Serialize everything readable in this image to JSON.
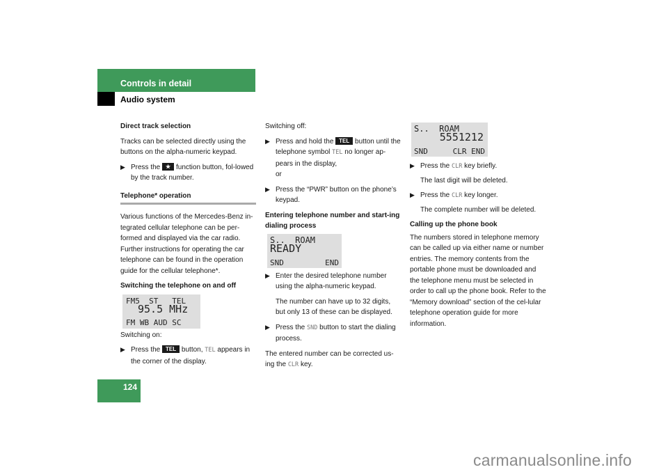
{
  "header": {
    "section_title": "Controls in detail",
    "subsection_title": "Audio system",
    "accent_color": "#3f9a5a"
  },
  "page_number": "124",
  "watermark": "carmanualsonline.info",
  "column1": {
    "direct_track_heading": "Direct track selection",
    "direct_track_text": "Tracks can be selected directly using the buttons on the alpha-numeric keypad.",
    "direct_track_bullet_pre": "Press the ",
    "direct_track_key": "★",
    "direct_track_bullet_post": " function button, fol-lowed by the track number.",
    "telephone_heading": "Telephone* operation",
    "telephone_text": "Various functions of the Mercedes-Benz in-tegrated cellular telephone can be per-formed and displayed via the car radio. Further instructions for operating the car telephone can be found in the operation guide for the cellular telephone*.",
    "switching_heading": "Switching the telephone on and off",
    "display1": {
      "row1": "FM5  ST   TEL",
      "row2": "95.5 MHz",
      "row3": "FM WB AUD SC"
    },
    "switching_on_label": "Switching on:",
    "switching_on_pre": "Press the ",
    "switching_on_key": "TEL",
    "switching_on_mid": " button, ",
    "switching_on_lcd": "TEL",
    "switching_on_post": " appears in the corner of the display."
  },
  "column2": {
    "switching_off_label": "Switching off:",
    "off_bullet1_pre": "Press and hold the ",
    "off_bullet1_key": "TEL",
    "off_bullet1_mid": " button until the telephone symbol ",
    "off_bullet1_lcd": "TEL",
    "off_bullet1_post": " no longer ap-pears in the display,",
    "off_or": "or",
    "off_bullet2": "Press the “PWR” button on the phone’s keypad.",
    "entering_heading": "Entering telephone number and start-ing dialing process",
    "display2": {
      "row1": "S..  ROAM",
      "row2": "READY",
      "row3_left": "SND",
      "row3_right": "END"
    },
    "enter_bullet": "Enter the desired telephone number using the alpha-numeric keypad.",
    "enter_note": "The number can have up to 32 digits, but only 13 of these can be displayed.",
    "snd_bullet_pre": "Press the ",
    "snd_bullet_lcd": "SND",
    "snd_bullet_post": " button to start the dialing process.",
    "correct_pre": "The entered number can be corrected us-ing the ",
    "correct_lcd": "CLR",
    "correct_post": " key."
  },
  "column3": {
    "display3": {
      "row1": "S..  ROAM",
      "row2": "5551212",
      "row3_left": "SND",
      "row3_right": "CLR END"
    },
    "clr1_pre": "Press the ",
    "clr1_lcd": "CLR",
    "clr1_post": " key briefly.",
    "clr1_note": "The last digit will be deleted.",
    "clr2_pre": "Press the ",
    "clr2_lcd": "CLR",
    "clr2_post": " key longer.",
    "clr2_note": "The complete number will be deleted.",
    "phonebook_heading": "Calling up the phone book",
    "phonebook_text": "The numbers stored in telephone memory can be called up via either name or number entries. The memory contents from the portable phone must be downloaded and the telephone menu must be selected in order to call up the phone book. Refer to the “Memory download” section of the cel-lular telephone operation guide for more information."
  }
}
